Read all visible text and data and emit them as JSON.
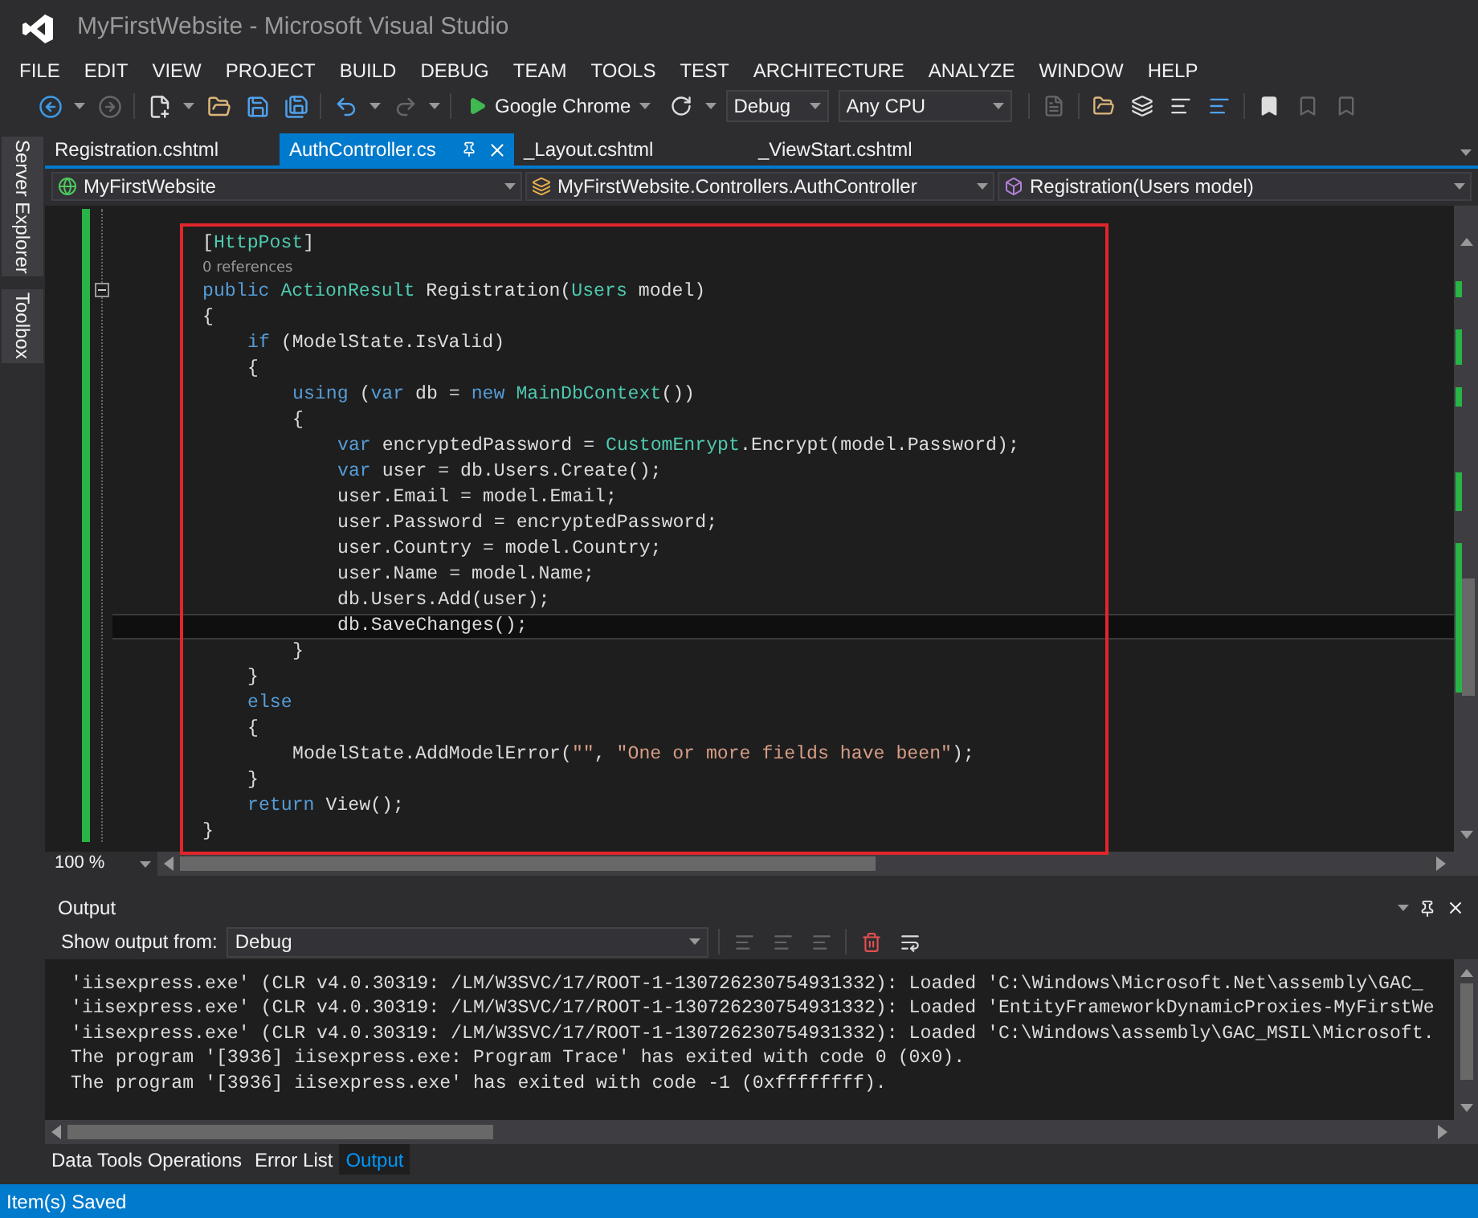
{
  "window": {
    "title": "MyFirstWebsite - Microsoft Visual Studio"
  },
  "menu": [
    "FILE",
    "EDIT",
    "VIEW",
    "PROJECT",
    "BUILD",
    "DEBUG",
    "TEAM",
    "TOOLS",
    "TEST",
    "ARCHITECTURE",
    "ANALYZE",
    "WINDOW",
    "HELP"
  ],
  "toolbar": {
    "run_target": "Google Chrome",
    "configuration": "Debug",
    "platform": "Any CPU"
  },
  "side_tabs": [
    "Server Explorer",
    "Toolbox"
  ],
  "doc_tabs": [
    {
      "label": "Registration.cshtml",
      "selected": false
    },
    {
      "label": "AuthController.cs",
      "selected": true
    },
    {
      "label": "_Layout.cshtml",
      "selected": false
    },
    {
      "label": "_ViewStart.cshtml",
      "selected": false
    }
  ],
  "nav_bar": {
    "project": "MyFirstWebsite",
    "type": "MyFirstWebsite.Controllers.AuthController",
    "member": "Registration(Users model)"
  },
  "editor": {
    "zoom": "100 %",
    "lines": [
      {
        "kind": "code",
        "current": false,
        "tokens": [
          {
            "kind": "plain",
            "text": "["
          },
          {
            "kind": "type",
            "text": "HttpPost"
          },
          {
            "kind": "plain",
            "text": "]"
          }
        ]
      },
      {
        "kind": "codelens",
        "text": "0 references"
      },
      {
        "kind": "code",
        "current": false,
        "tokens": [
          {
            "kind": "keyword",
            "text": "public "
          },
          {
            "kind": "type",
            "text": "ActionResult"
          },
          {
            "kind": "plain",
            "text": " Registration("
          },
          {
            "kind": "type",
            "text": "Users"
          },
          {
            "kind": "plain",
            "text": " model)"
          }
        ]
      },
      {
        "kind": "code",
        "current": false,
        "tokens": [
          {
            "kind": "plain",
            "text": "{"
          }
        ],
        "children": [
          {
            "kind": "code",
            "current": false,
            "tokens": [
              {
                "kind": "keyword",
                "text": "if"
              },
              {
                "kind": "plain",
                "text": " (ModelState.IsValid)"
              }
            ]
          },
          {
            "kind": "code",
            "current": false,
            "tokens": [
              {
                "kind": "plain",
                "text": "{"
              }
            ],
            "children": [
              {
                "kind": "code",
                "current": false,
                "tokens": [
                  {
                    "kind": "keyword",
                    "text": "using"
                  },
                  {
                    "kind": "plain",
                    "text": " ("
                  },
                  {
                    "kind": "keyword",
                    "text": "var"
                  },
                  {
                    "kind": "plain",
                    "text": " db = "
                  },
                  {
                    "kind": "keyword",
                    "text": "new "
                  },
                  {
                    "kind": "type",
                    "text": "MainDbContext"
                  },
                  {
                    "kind": "plain",
                    "text": "())"
                  }
                ]
              },
              {
                "kind": "code",
                "current": false,
                "tokens": [
                  {
                    "kind": "plain",
                    "text": "{"
                  }
                ],
                "children": [
                  {
                    "kind": "code",
                    "current": false,
                    "tokens": [
                      {
                        "kind": "keyword",
                        "text": "var"
                      },
                      {
                        "kind": "plain",
                        "text": " encryptedPassword = "
                      },
                      {
                        "kind": "type",
                        "text": "CustomEnrypt"
                      },
                      {
                        "kind": "plain",
                        "text": ".Encrypt(model.Password);"
                      }
                    ]
                  },
                  {
                    "kind": "code",
                    "current": false,
                    "tokens": [
                      {
                        "kind": "keyword",
                        "text": "var"
                      },
                      {
                        "kind": "plain",
                        "text": " user = db.Users.Create();"
                      }
                    ]
                  },
                  {
                    "kind": "code",
                    "current": false,
                    "tokens": [
                      {
                        "kind": "plain",
                        "text": "user.Email = model.Email;"
                      }
                    ]
                  },
                  {
                    "kind": "code",
                    "current": false,
                    "tokens": [
                      {
                        "kind": "plain",
                        "text": "user.Password = encryptedPassword;"
                      }
                    ]
                  },
                  {
                    "kind": "code",
                    "current": false,
                    "tokens": [
                      {
                        "kind": "plain",
                        "text": "user.Country = model.Country;"
                      }
                    ]
                  },
                  {
                    "kind": "code",
                    "current": false,
                    "tokens": [
                      {
                        "kind": "plain",
                        "text": "user.Name = model.Name;"
                      }
                    ]
                  },
                  {
                    "kind": "code",
                    "current": false,
                    "tokens": [
                      {
                        "kind": "plain",
                        "text": "db.Users.Add(user);"
                      }
                    ]
                  },
                  {
                    "kind": "code",
                    "current": true,
                    "tokens": [
                      {
                        "kind": "plain",
                        "text": "db.SaveChanges();"
                      }
                    ]
                  }
                ]
              },
              {
                "kind": "code",
                "current": false,
                "tokens": [
                  {
                    "kind": "plain",
                    "text": "}"
                  }
                ]
              }
            ]
          },
          {
            "kind": "code",
            "current": false,
            "tokens": [
              {
                "kind": "plain",
                "text": "}"
              }
            ]
          },
          {
            "kind": "code",
            "current": false,
            "tokens": [
              {
                "kind": "keyword",
                "text": "else"
              }
            ]
          },
          {
            "kind": "code",
            "current": false,
            "tokens": [
              {
                "kind": "plain",
                "text": "{"
              }
            ],
            "children": [
              {
                "kind": "code",
                "current": false,
                "tokens": [
                  {
                    "kind": "plain",
                    "text": "ModelState.AddModelError("
                  },
                  {
                    "kind": "string",
                    "text": "\"\""
                  },
                  {
                    "kind": "plain",
                    "text": ", "
                  },
                  {
                    "kind": "string",
                    "text": "\"One or more fields have been\""
                  },
                  {
                    "kind": "plain",
                    "text": ");"
                  }
                ]
              }
            ]
          },
          {
            "kind": "code",
            "current": false,
            "tokens": [
              {
                "kind": "plain",
                "text": "}"
              }
            ]
          },
          {
            "kind": "code",
            "current": false,
            "tokens": [
              {
                "kind": "keyword",
                "text": "return"
              },
              {
                "kind": "plain",
                "text": " View();"
              }
            ]
          }
        ]
      },
      {
        "kind": "code",
        "current": false,
        "tokens": [
          {
            "kind": "plain",
            "text": "}"
          }
        ]
      }
    ]
  },
  "output": {
    "title": "Output",
    "source_label": "Show output from:",
    "source": "Debug",
    "lines": [
      "'iisexpress.exe' (CLR v4.0.30319: /LM/W3SVC/17/ROOT-1-130726230754931332): Loaded 'C:\\Windows\\Microsoft.Net\\assembly\\GAC_",
      "'iisexpress.exe' (CLR v4.0.30319: /LM/W3SVC/17/ROOT-1-130726230754931332): Loaded 'EntityFrameworkDynamicProxies-MyFirstWe",
      "'iisexpress.exe' (CLR v4.0.30319: /LM/W3SVC/17/ROOT-1-130726230754931332): Loaded 'C:\\Windows\\assembly\\GAC_MSIL\\Microsoft.",
      "The program '[3936] iisexpress.exe: Program Trace' has exited with code 0 (0x0).",
      "The program '[3936] iisexpress.exe' has exited with code -1 (0xffffffff)."
    ]
  },
  "bottom_tabs": [
    {
      "label": "Data Tools Operations",
      "selected": false
    },
    {
      "label": "Error List",
      "selected": false
    },
    {
      "label": "Output",
      "selected": true
    }
  ],
  "status_bar": {
    "text": "Item(s) Saved"
  }
}
